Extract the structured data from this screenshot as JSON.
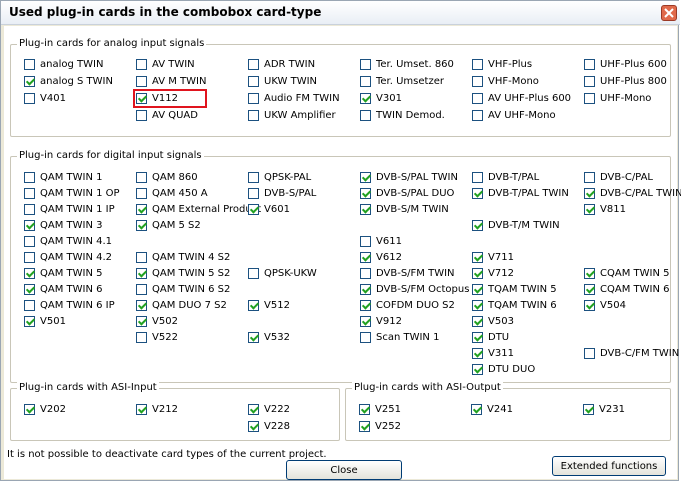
{
  "window": {
    "title": "Used plug-in cards in the combobox card-type"
  },
  "message": "It is not possible to deactivate card types of the current project.",
  "buttons": {
    "close": "Close",
    "extended": "Extended functions"
  },
  "groups": {
    "analog": {
      "legend": "Plug-in cards for analog input signals",
      "items": [
        {
          "label": "analog TWIN",
          "checked": false,
          "col": 0,
          "row": 0
        },
        {
          "label": "analog S TWIN",
          "checked": true,
          "col": 0,
          "row": 1
        },
        {
          "label": "V401",
          "checked": false,
          "col": 0,
          "row": 2
        },
        {
          "label": "AV TWIN",
          "checked": false,
          "col": 1,
          "row": 0
        },
        {
          "label": "AV M TWIN",
          "checked": false,
          "col": 1,
          "row": 1
        },
        {
          "label": "V112",
          "checked": true,
          "col": 1,
          "row": 2,
          "highlight": true
        },
        {
          "label": "AV QUAD",
          "checked": false,
          "col": 1,
          "row": 3
        },
        {
          "label": "ADR TWIN",
          "checked": false,
          "col": 2,
          "row": 0
        },
        {
          "label": "UKW TWIN",
          "checked": false,
          "col": 2,
          "row": 1
        },
        {
          "label": "Audio FM TWIN",
          "checked": false,
          "col": 2,
          "row": 2
        },
        {
          "label": "UKW Amplifier",
          "checked": false,
          "col": 2,
          "row": 3
        },
        {
          "label": "Ter. Umset. 860",
          "checked": false,
          "col": 3,
          "row": 0
        },
        {
          "label": "Ter. Umsetzer",
          "checked": false,
          "col": 3,
          "row": 1
        },
        {
          "label": "V301",
          "checked": true,
          "col": 3,
          "row": 2
        },
        {
          "label": "TWIN Demod.",
          "checked": false,
          "col": 3,
          "row": 3
        },
        {
          "label": "VHF-Plus",
          "checked": false,
          "col": 4,
          "row": 0
        },
        {
          "label": "VHF-Mono",
          "checked": false,
          "col": 4,
          "row": 1
        },
        {
          "label": "AV UHF-Plus 600",
          "checked": false,
          "col": 4,
          "row": 2
        },
        {
          "label": "AV UHF-Mono",
          "checked": false,
          "col": 4,
          "row": 3
        },
        {
          "label": "UHF-Plus 600",
          "checked": false,
          "col": 5,
          "row": 0
        },
        {
          "label": "UHF-Plus 800",
          "checked": false,
          "col": 5,
          "row": 1
        },
        {
          "label": "UHF-Mono",
          "checked": false,
          "col": 5,
          "row": 2
        }
      ]
    },
    "digital": {
      "legend": "Plug-in cards for digital input signals",
      "items": [
        {
          "label": "QAM TWIN 1",
          "checked": false,
          "col": 0,
          "row": 0
        },
        {
          "label": "QAM TWIN 1 OP",
          "checked": false,
          "col": 0,
          "row": 1
        },
        {
          "label": "QAM TWIN 1 IP",
          "checked": false,
          "col": 0,
          "row": 2
        },
        {
          "label": "QAM TWIN 3",
          "checked": true,
          "col": 0,
          "row": 3
        },
        {
          "label": "QAM TWIN 4.1",
          "checked": false,
          "col": 0,
          "row": 4
        },
        {
          "label": "QAM TWIN 4.2",
          "checked": false,
          "col": 0,
          "row": 5
        },
        {
          "label": "QAM TWIN 5",
          "checked": true,
          "col": 0,
          "row": 6
        },
        {
          "label": "QAM TWIN 6",
          "checked": true,
          "col": 0,
          "row": 7
        },
        {
          "label": "QAM TWIN 6 IP",
          "checked": false,
          "col": 0,
          "row": 8
        },
        {
          "label": "V501",
          "checked": true,
          "col": 0,
          "row": 9
        },
        {
          "label": "QAM 860",
          "checked": false,
          "col": 1,
          "row": 0
        },
        {
          "label": "QAM 450 A",
          "checked": false,
          "col": 1,
          "row": 1
        },
        {
          "label": "QAM External Product",
          "checked": true,
          "col": 1,
          "row": 2
        },
        {
          "label": "QAM 5 S2",
          "checked": true,
          "col": 1,
          "row": 3
        },
        {
          "label": "QAM TWIN 4 S2",
          "checked": false,
          "col": 1,
          "row": 5
        },
        {
          "label": "QAM TWIN 5 S2",
          "checked": true,
          "col": 1,
          "row": 6
        },
        {
          "label": "QAM TWIN 6 S2",
          "checked": false,
          "col": 1,
          "row": 7
        },
        {
          "label": "QAM DUO 7 S2",
          "checked": true,
          "col": 1,
          "row": 8
        },
        {
          "label": "V502",
          "checked": true,
          "col": 1,
          "row": 9
        },
        {
          "label": "V522",
          "checked": false,
          "col": 1,
          "row": 10
        },
        {
          "label": "QPSK-PAL",
          "checked": false,
          "col": 2,
          "row": 0
        },
        {
          "label": "DVB-S/PAL",
          "checked": false,
          "col": 2,
          "row": 1
        },
        {
          "label": "V601",
          "checked": true,
          "col": 2,
          "row": 2
        },
        {
          "label": "QPSK-UKW",
          "checked": false,
          "col": 2,
          "row": 6
        },
        {
          "label": "V512",
          "checked": true,
          "col": 2,
          "row": 8
        },
        {
          "label": "V532",
          "checked": true,
          "col": 2,
          "row": 10
        },
        {
          "label": "DVB-S/PAL TWIN",
          "checked": true,
          "col": 3,
          "row": 0
        },
        {
          "label": "DVB-S/PAL DUO",
          "checked": true,
          "col": 3,
          "row": 1
        },
        {
          "label": "DVB-S/M TWIN",
          "checked": true,
          "col": 3,
          "row": 2
        },
        {
          "label": "V611",
          "checked": false,
          "col": 3,
          "row": 4
        },
        {
          "label": "V612",
          "checked": true,
          "col": 3,
          "row": 5
        },
        {
          "label": "DVB-S/FM TWIN",
          "checked": false,
          "col": 3,
          "row": 6
        },
        {
          "label": "DVB-S/FM Octopus",
          "checked": true,
          "col": 3,
          "row": 7
        },
        {
          "label": "COFDM DUO S2",
          "checked": true,
          "col": 3,
          "row": 8
        },
        {
          "label": "V912",
          "checked": true,
          "col": 3,
          "row": 9
        },
        {
          "label": "Scan TWIN 1",
          "checked": false,
          "col": 3,
          "row": 10
        },
        {
          "label": "DVB-T/PAL",
          "checked": false,
          "col": 4,
          "row": 0
        },
        {
          "label": "DVB-T/PAL TWIN",
          "checked": true,
          "col": 4,
          "row": 1
        },
        {
          "label": "DVB-T/M TWIN",
          "checked": true,
          "col": 4,
          "row": 3
        },
        {
          "label": "V711",
          "checked": true,
          "col": 4,
          "row": 5
        },
        {
          "label": "V712",
          "checked": true,
          "col": 4,
          "row": 6
        },
        {
          "label": "TQAM TWIN 5",
          "checked": true,
          "col": 4,
          "row": 7
        },
        {
          "label": "TQAM TWIN 6",
          "checked": true,
          "col": 4,
          "row": 8
        },
        {
          "label": "V503",
          "checked": true,
          "col": 4,
          "row": 9
        },
        {
          "label": "DTU",
          "checked": true,
          "col": 4,
          "row": 10
        },
        {
          "label": "V311",
          "checked": true,
          "col": 4,
          "row": 11
        },
        {
          "label": "DTU DUO",
          "checked": true,
          "col": 4,
          "row": 12
        },
        {
          "label": "DVB-C/PAL",
          "checked": false,
          "col": 5,
          "row": 0
        },
        {
          "label": "DVB-C/PAL TWIN",
          "checked": true,
          "col": 5,
          "row": 1
        },
        {
          "label": "V811",
          "checked": true,
          "col": 5,
          "row": 2
        },
        {
          "label": "CQAM TWIN 5",
          "checked": true,
          "col": 5,
          "row": 6
        },
        {
          "label": "CQAM TWIN 6",
          "checked": true,
          "col": 5,
          "row": 7
        },
        {
          "label": "V504",
          "checked": true,
          "col": 5,
          "row": 8
        },
        {
          "label": "DVB-C/FM TWIN",
          "checked": false,
          "col": 5,
          "row": 11
        }
      ]
    },
    "asi_input": {
      "legend": "Plug-in cards with ASI-Input",
      "items": [
        {
          "label": "V202",
          "checked": true,
          "col": 0,
          "row": 0
        },
        {
          "label": "V212",
          "checked": true,
          "col": 1,
          "row": 0
        },
        {
          "label": "V222",
          "checked": true,
          "col": 2,
          "row": 0
        },
        {
          "label": "V228",
          "checked": true,
          "col": 2,
          "row": 1
        }
      ]
    },
    "asi_output": {
      "legend": "Plug-in cards with ASI-Output",
      "items": [
        {
          "label": "V251",
          "checked": true,
          "col": 0,
          "row": 0
        },
        {
          "label": "V252",
          "checked": true,
          "col": 0,
          "row": 1
        },
        {
          "label": "V241",
          "checked": true,
          "col": 1,
          "row": 0
        },
        {
          "label": "V231",
          "checked": true,
          "col": 2,
          "row": 0
        }
      ]
    }
  }
}
